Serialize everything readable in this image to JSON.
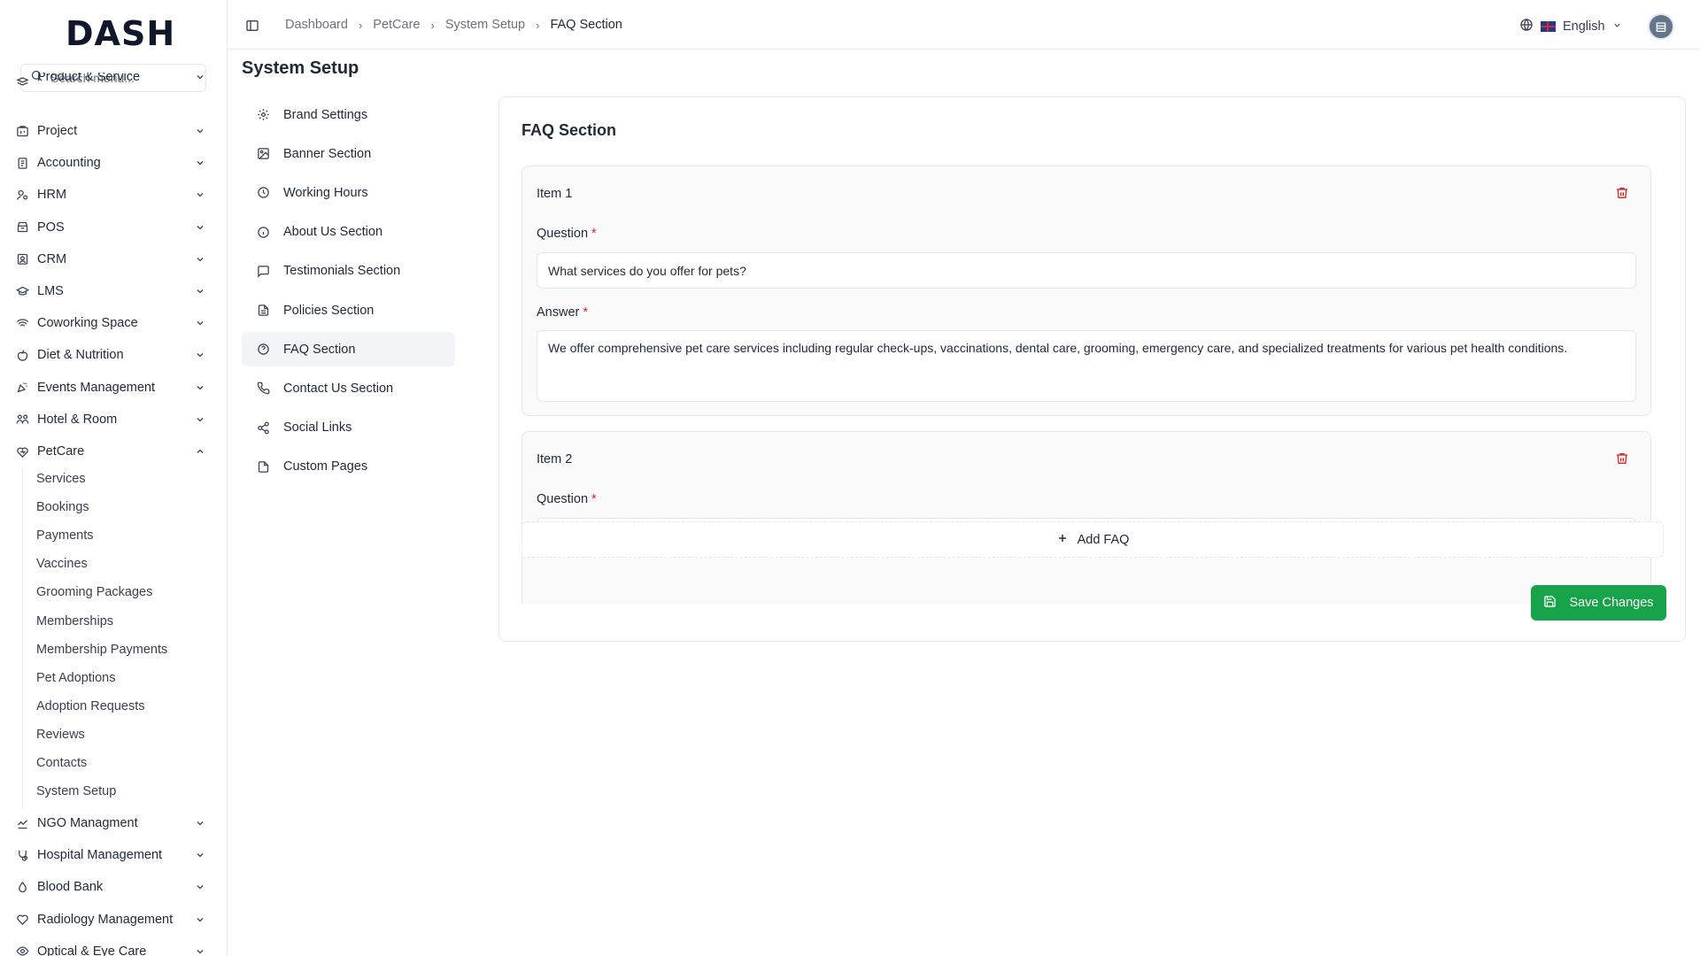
{
  "app": {
    "logo_text": "DASH"
  },
  "search": {
    "placeholder": "Search menu..."
  },
  "sidebar": {
    "top_cut_label": "Product & Service",
    "items": [
      {
        "label": "Project",
        "icon": "project-icon"
      },
      {
        "label": "Accounting",
        "icon": "accounting-icon"
      },
      {
        "label": "HRM",
        "icon": "hrm-icon"
      },
      {
        "label": "POS",
        "icon": "pos-icon"
      },
      {
        "label": "CRM",
        "icon": "crm-icon"
      },
      {
        "label": "LMS",
        "icon": "lms-icon"
      },
      {
        "label": "Coworking Space",
        "icon": "coworking-icon"
      },
      {
        "label": "Diet & Nutrition",
        "icon": "diet-icon"
      },
      {
        "label": "Events Management",
        "icon": "events-icon"
      },
      {
        "label": "Hotel & Room",
        "icon": "hotel-icon"
      },
      {
        "label": "PetCare",
        "icon": "petcare-icon",
        "expanded": true
      }
    ],
    "petcare_sub": [
      "Services",
      "Bookings",
      "Payments",
      "Vaccines",
      "Grooming Packages",
      "Memberships",
      "Membership Payments",
      "Pet Adoptions",
      "Adoption Requests",
      "Reviews",
      "Contacts",
      "System Setup"
    ],
    "items_after": [
      {
        "label": "NGO Managment",
        "icon": "ngo-icon"
      },
      {
        "label": "Hospital Management",
        "icon": "hospital-icon"
      },
      {
        "label": "Blood Bank",
        "icon": "blood-bank-icon"
      },
      {
        "label": "Radiology Management",
        "icon": "radiology-icon"
      },
      {
        "label": "Optical & Eye Care",
        "icon": "optical-icon"
      }
    ]
  },
  "breadcrumb": [
    "Dashboard",
    "PetCare",
    "System Setup",
    "FAQ Section"
  ],
  "language": {
    "label": "English"
  },
  "page": {
    "title": "System Setup"
  },
  "subnav": [
    {
      "label": "Brand Settings",
      "icon": "gear-icon"
    },
    {
      "label": "Banner Section",
      "icon": "image-icon"
    },
    {
      "label": "Working Hours",
      "icon": "clock-icon"
    },
    {
      "label": "About Us Section",
      "icon": "info-icon"
    },
    {
      "label": "Testimonials Section",
      "icon": "message-icon"
    },
    {
      "label": "Policies Section",
      "icon": "file-text-icon"
    },
    {
      "label": "FAQ Section",
      "icon": "help-circle-icon",
      "active": true
    },
    {
      "label": "Contact Us Section",
      "icon": "phone-icon"
    },
    {
      "label": "Social Links",
      "icon": "share-icon"
    },
    {
      "label": "Custom Pages",
      "icon": "file-icon"
    }
  ],
  "faq": {
    "title": "FAQ Section",
    "question_label": "Question",
    "answer_label": "Answer",
    "required_mark": "*",
    "items": [
      {
        "label": "Item 1",
        "question": "What services do you offer for pets?",
        "answer": "We offer comprehensive pet care services including regular check-ups, vaccinations, dental care, grooming, emergency care, and specialized treatments for various pet health conditions."
      },
      {
        "label": "Item 2",
        "question": "",
        "answer": ""
      }
    ],
    "add_label": "Add FAQ",
    "save_label": "Save Changes"
  },
  "colors": {
    "accent": "#16a34a",
    "danger": "#dc2626"
  }
}
